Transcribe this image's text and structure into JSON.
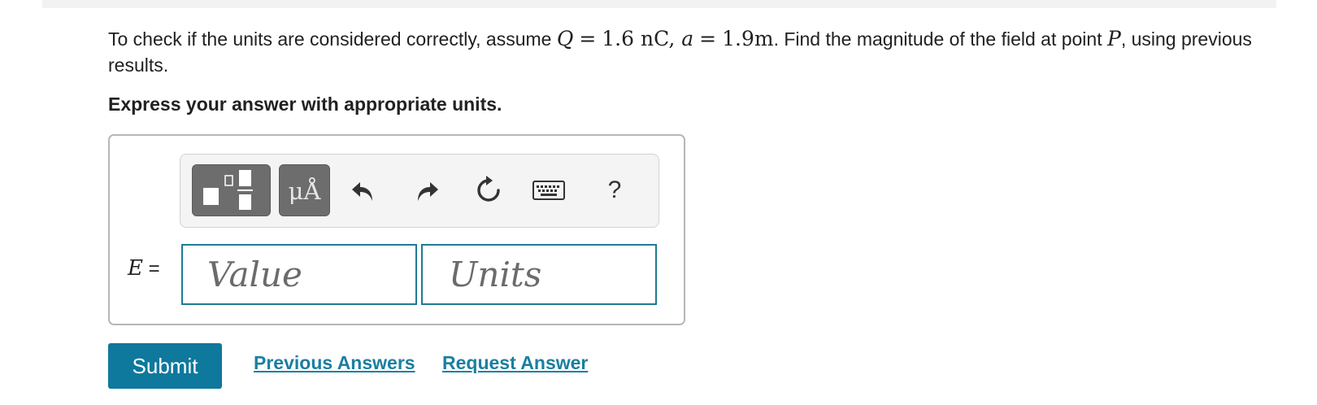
{
  "problem": {
    "text_before": "To check if the units are considered correctly, assume ",
    "math_q": "Q",
    "math_eq1": "=",
    "math_q_value": "1.6 nC",
    "math_comma": ",",
    "math_a": "a",
    "math_eq2": "=",
    "math_a_value": "1.9m",
    "text_after": ". Find the magnitude of the field at point ",
    "math_p": "P",
    "text_line2": ", using previous results."
  },
  "instruction": "Express your answer with appropriate units.",
  "toolbar": {
    "units_label": "μÅ",
    "help_label": "?",
    "icons": [
      "templates-icon",
      "units-icon",
      "undo-icon",
      "redo-icon",
      "reset-icon",
      "keyboard-icon",
      "help-icon"
    ]
  },
  "answer": {
    "variable": "E",
    "equals": "=",
    "value_placeholder": "Value",
    "units_placeholder": "Units"
  },
  "actions": {
    "submit_label": "Submit",
    "previous_answers_label": "Previous Answers",
    "request_answer_label": "Request Answer"
  },
  "colors": {
    "accent": "#0f789d",
    "link": "#1a7fa0",
    "field_border": "#1f7a94",
    "toolbar_button": "#6d6d6d"
  }
}
